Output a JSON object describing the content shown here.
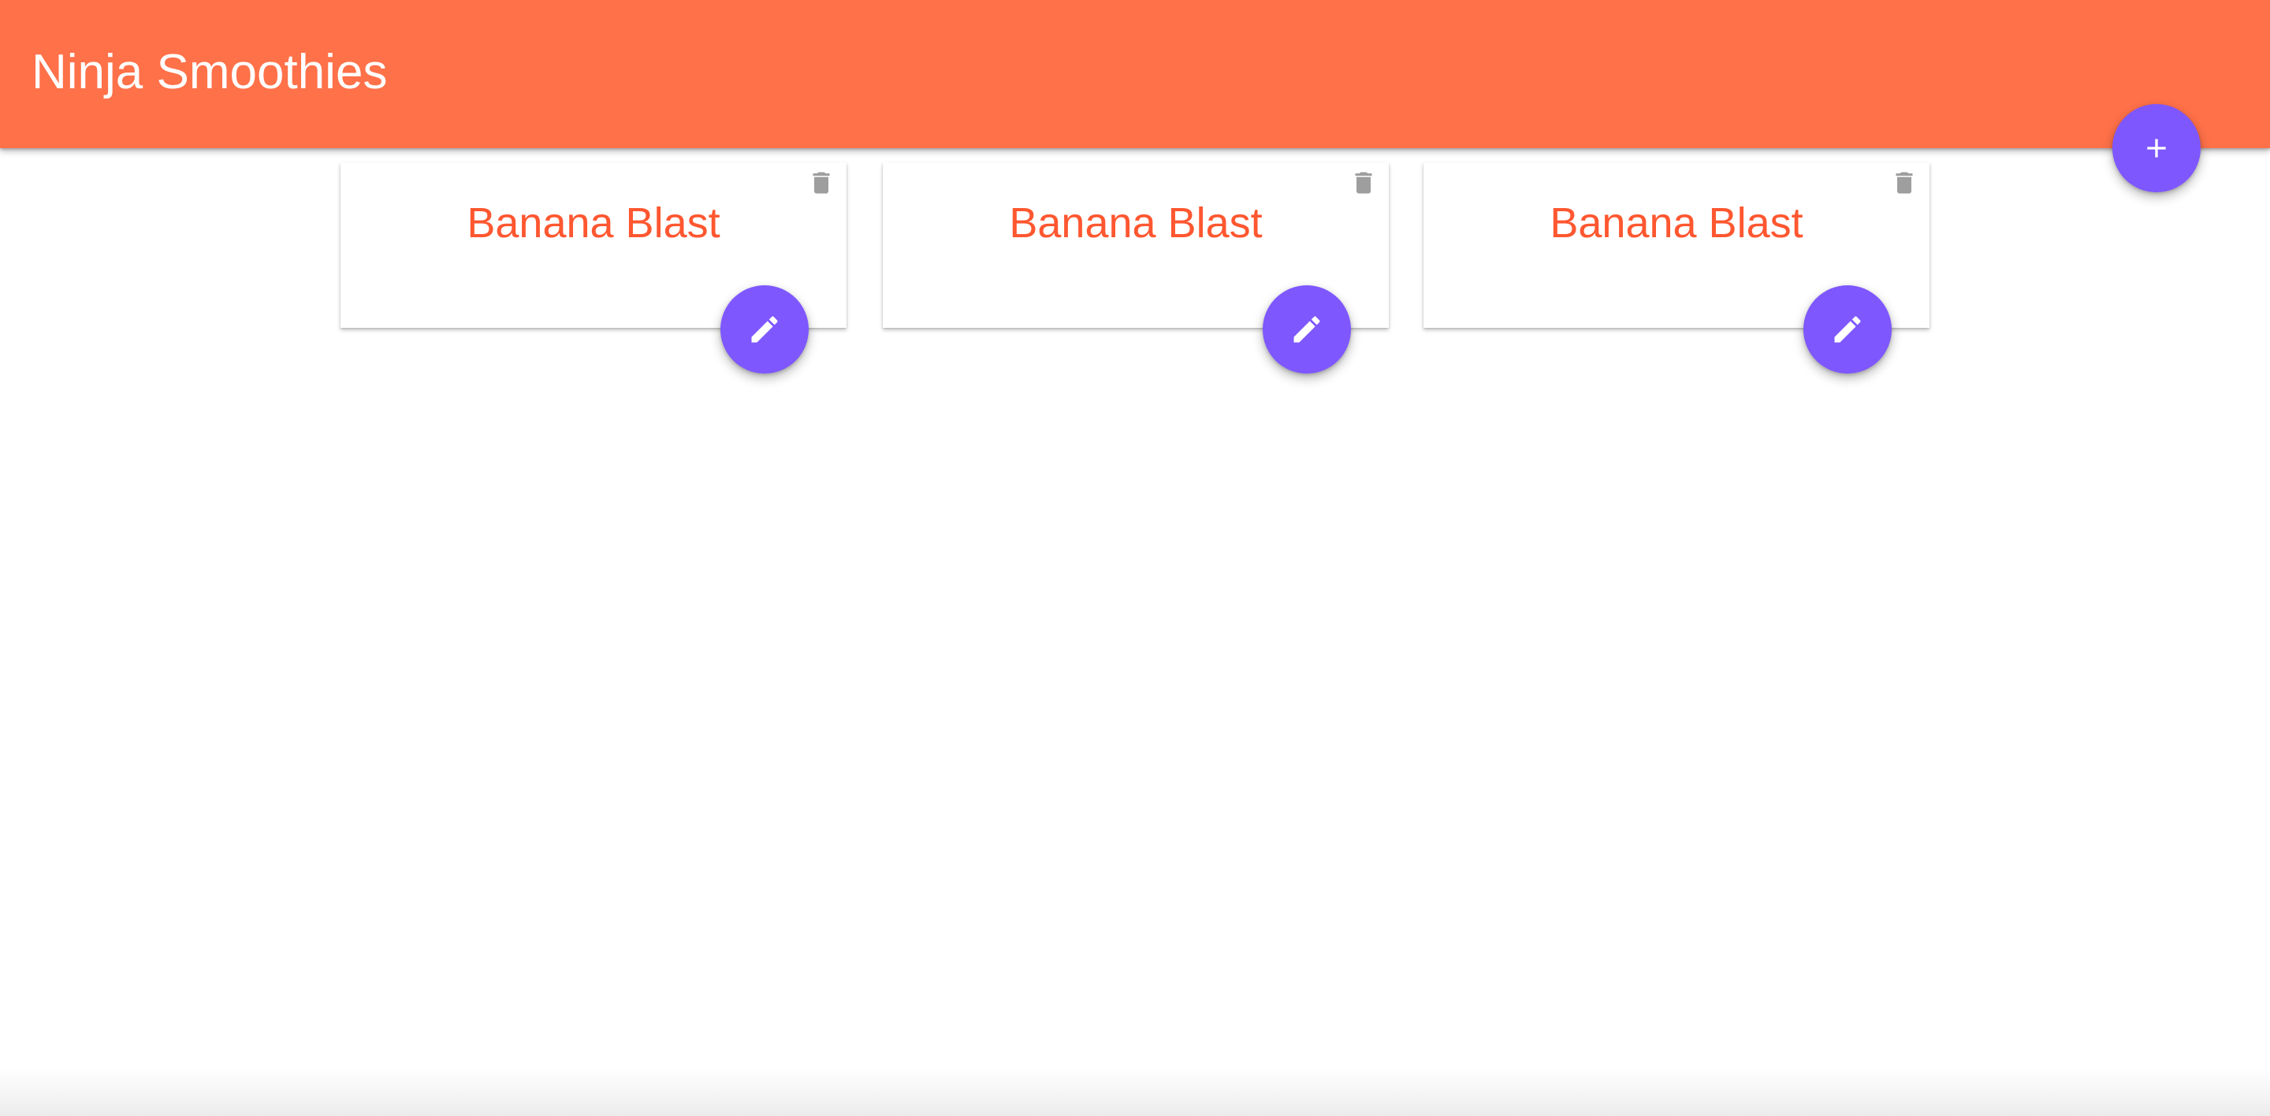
{
  "navbar": {
    "brand": "Ninja Smoothies",
    "add_button_icon": "plus-icon",
    "color": "#ff7149"
  },
  "smoothies": [
    {
      "title": "Banana Blast",
      "delete_icon": "trash-icon",
      "edit_icon": "pencil-icon"
    },
    {
      "title": "Banana Blast",
      "delete_icon": "trash-icon",
      "edit_icon": "pencil-icon"
    },
    {
      "title": "Banana Blast",
      "delete_icon": "trash-icon",
      "edit_icon": "pencil-icon"
    }
  ],
  "colors": {
    "accent": "#7e57ff",
    "title_text": "#ff5730",
    "icon_grey": "#9e9e9e"
  }
}
